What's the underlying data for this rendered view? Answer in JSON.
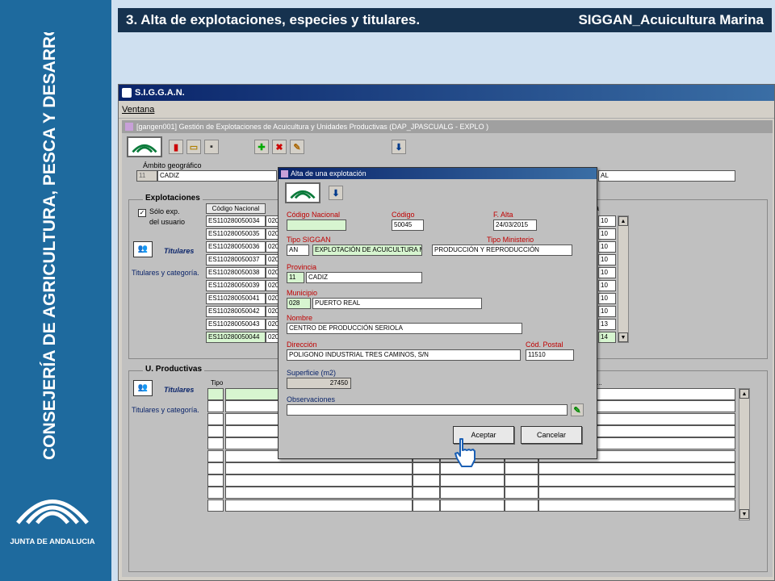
{
  "slide": {
    "title_left": "3. Alta de explotaciones, especies y titulares.",
    "title_right": "SIGGAN_Acuicultura Marina",
    "vertical_title": "CONSEJERÍA DE AGRICULTURA, PESCA Y DESARROLLO RURAL",
    "logo_text": "JUNTA DE ANDALUCIA"
  },
  "app": {
    "title": "S.I.G.G.A.N.",
    "menu": [
      "Ventana"
    ],
    "inner_title": "[gangen001] Gestión de Explotaciones de Acuicultura y Unidades Productivas (DAP_JPASCUALG - EXPLO )",
    "ambito_label": "Ámbito geográfico",
    "ambito_code": "11",
    "ambito_name": "CADIZ",
    "ambito_right_suffix": "AL",
    "explotaciones_title": "Explotaciones",
    "solo_exp_label": "Sólo exp.",
    "del_usuario_label": "del usuario",
    "titulares_label": "Titulares",
    "titulares_categoria_label": "Titulares y categoría.",
    "codigo_nacional_header": "Código Nacional",
    "col_right_header": "a",
    "explotaciones_rows": [
      {
        "codigo": "ES110280050034",
        "c2": "020",
        "r": "10"
      },
      {
        "codigo": "ES110280050035",
        "c2": "020",
        "r": "10"
      },
      {
        "codigo": "ES110280050036",
        "c2": "020",
        "r": "10"
      },
      {
        "codigo": "ES110280050037",
        "c2": "020",
        "r": "10"
      },
      {
        "codigo": "ES110280050038",
        "c2": "020",
        "r": "10"
      },
      {
        "codigo": "ES110280050039",
        "c2": "020",
        "r": "10"
      },
      {
        "codigo": "ES110280050041",
        "c2": "020",
        "r": "10"
      },
      {
        "codigo": "ES110280050042",
        "c2": "020",
        "r": "10"
      },
      {
        "codigo": "ES110280050043",
        "c2": "020",
        "r": "13"
      },
      {
        "codigo": "ES110280050044",
        "c2": "020",
        "r": "14"
      }
    ],
    "uproductivas_title": "U. Productivas",
    "tipo_header": "Tipo",
    "up_right_header": "...",
    "up_first_cell": "."
  },
  "modal": {
    "title": "Alta de una explotación",
    "codigo_nacional_label": "Código Nacional",
    "codigo_nacional_value": "",
    "codigo_label": "Código",
    "codigo_value": "50045",
    "f_alta_label": "F. Alta",
    "f_alta_value": "24/03/2015",
    "tipo_siggan_label": "Tipo SIGGAN",
    "tipo_siggan_code": "AN",
    "tipo_siggan_value": "EXPLOTACIÓN DE ACUICULTURA M",
    "tipo_ministerio_label": "Tipo Ministerio",
    "tipo_ministerio_value": "PRODUCCIÓN Y REPRODUCCIÓN",
    "provincia_label": "Provincia",
    "provincia_code": "11",
    "provincia_value": "CADIZ",
    "municipio_label": "Municipio",
    "municipio_code": "028",
    "municipio_value": "PUERTO REAL",
    "nombre_label": "Nombre",
    "nombre_value": "CENTRO DE PRODUCCIÓN SERIOLA",
    "direccion_label": "Dirección",
    "direccion_value": "POLIGONO INDUSTRIAL TRES CAMINOS, S/N",
    "cod_postal_label": "Cód. Postal",
    "cod_postal_value": "11510",
    "superficie_label": "Superficie (m2)",
    "superficie_value": "27450",
    "observaciones_label": "Observaciones",
    "observaciones_value": "",
    "accept_label": "Aceptar",
    "cancel_label": "Cancelar"
  },
  "colors": {
    "band": "#1e6a9e",
    "topbar": "#16324f",
    "required_label": "#c00000",
    "required_field": "#d7f5d0"
  }
}
